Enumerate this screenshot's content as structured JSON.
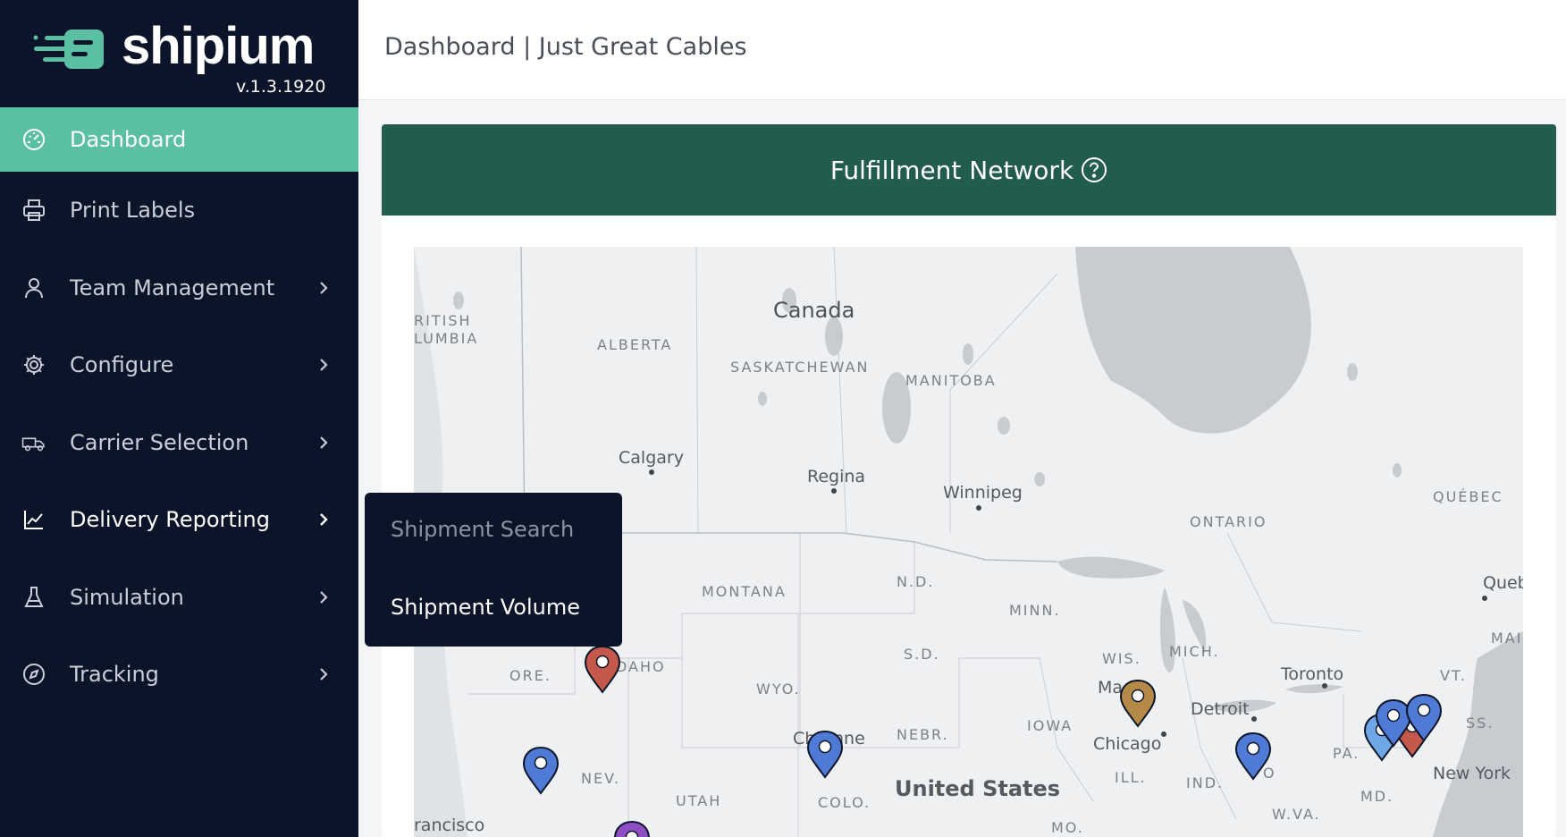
{
  "brand": {
    "name": "shipium",
    "version": "v.1.3.1920",
    "accent": "#5bbfa4",
    "sidebar_bg": "#0b1428"
  },
  "sidebar": {
    "items": [
      {
        "label": "Dashboard",
        "icon": "dashboard-gauge-icon",
        "active": true,
        "has_submenu": false
      },
      {
        "label": "Print Labels",
        "icon": "printer-icon",
        "active": false,
        "has_submenu": false
      },
      {
        "label": "Team Management",
        "icon": "user-icon",
        "active": false,
        "has_submenu": true
      },
      {
        "label": "Configure",
        "icon": "gear-icon",
        "active": false,
        "has_submenu": true
      },
      {
        "label": "Carrier Selection",
        "icon": "truck-icon",
        "active": false,
        "has_submenu": true
      },
      {
        "label": "Delivery Reporting",
        "icon": "line-chart-icon",
        "active": false,
        "has_submenu": true
      },
      {
        "label": "Simulation",
        "icon": "flask-icon",
        "active": false,
        "has_submenu": true
      },
      {
        "label": "Tracking",
        "icon": "compass-icon",
        "active": false,
        "has_submenu": true
      }
    ]
  },
  "flyout": {
    "items": [
      {
        "label": "Shipment Search"
      },
      {
        "label": "Shipment Volume"
      }
    ]
  },
  "header": {
    "title": "Dashboard | Just Great Cables"
  },
  "card": {
    "title": "Fulfillment Network",
    "header_color": "#225c4e"
  },
  "map": {
    "labels": {
      "canada": "Canada",
      "british_columbia_1": "RITISH",
      "british_columbia_2": "LUMBIA",
      "alberta": "ALBERTA",
      "saskatchewan": "SASKATCHEWAN",
      "manitoba": "MANITOBA",
      "ontario": "ONTARIO",
      "quebec_region": "QUÉBEC",
      "calgary": "Calgary",
      "regina": "Regina",
      "winnipeg": "Winnipeg",
      "quebec_city": "Quebec",
      "montana": "MONTANA",
      "nd": "N.D.",
      "minn": "MINN.",
      "sd": "S.D.",
      "ore": "ORE.",
      "idaho": "DAHO",
      "wyo": "WYO.",
      "wis": "WIS.",
      "mich": "MICH.",
      "madison": "Madis",
      "toronto": "Toronto",
      "vt": "VT.",
      "mai": "MAI",
      "detroit": "Detroit",
      "iowa": "IOWA",
      "nebr": "NEBR.",
      "cheyenne_1": "Ch",
      "cheyenne_2": "nne",
      "chicago": "Chicago",
      "nev": "NEV.",
      "utah": "UTAH",
      "colo": "COLO.",
      "united_states": "United States",
      "ill": "ILL.",
      "ind": "IND.",
      "ohio": "O",
      "pa": "PA.",
      "mass": "SS.",
      "md": "MD.",
      "new_york": "New York",
      "wva": "W.VA.",
      "mo": "MO.",
      "san_francisco": "rancisco"
    },
    "pins": [
      {
        "color": "#c4584a",
        "label": "pin-idaho"
      },
      {
        "color": "#4f7bd6",
        "label": "pin-nevada"
      },
      {
        "color": "#4f7bd6",
        "label": "pin-cheyenne"
      },
      {
        "color": "#b58a47",
        "label": "pin-chicago"
      },
      {
        "color": "#4f7bd6",
        "label": "pin-ohio"
      },
      {
        "color": "#6fa6e6",
        "label": "pin-pa-1"
      },
      {
        "color": "#4f7bd6",
        "label": "pin-pa-2"
      },
      {
        "color": "#c4584a",
        "label": "pin-ny-red"
      },
      {
        "color": "#4f7bd6",
        "label": "pin-ny-blue"
      },
      {
        "color": "#8e4fc5",
        "label": "pin-california"
      }
    ]
  }
}
